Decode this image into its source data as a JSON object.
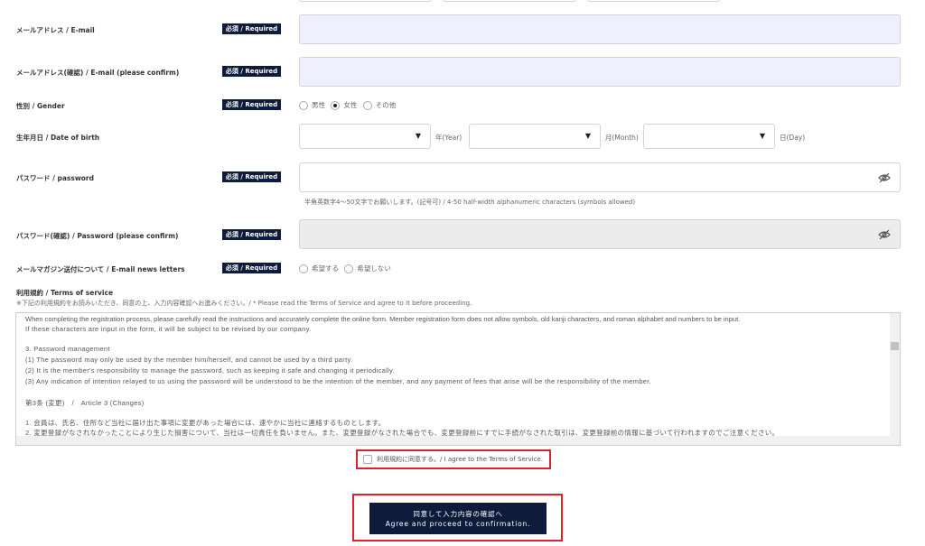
{
  "fields": {
    "email": {
      "label": "メールアドレス / E-mail",
      "badge": "必須 / Required"
    },
    "email_confirm": {
      "label": "メールアドレス(確認) / E-mail (please confirm)",
      "badge": "必須 / Required"
    },
    "gender": {
      "label": "性別 / Gender",
      "badge": "必須 / Required",
      "options": [
        "男性",
        "女性",
        "その他"
      ],
      "selected": "女性"
    },
    "dob": {
      "label": "生年月日 / Date of birth",
      "year_unit": "年(Year)",
      "month_unit": "月(Month)",
      "day_unit": "日(Day)"
    },
    "password": {
      "label": "パスワード / password",
      "badge": "必須 / Required",
      "hint": "半角英数字4～50文字でお願いします。(記号可) / 4-50 half-width alphanumeric characters (symbols allowed)"
    },
    "password_confirm": {
      "label": "パスワード(確認) / Password (please confirm)",
      "badge": "必須 / Required"
    },
    "newsletter": {
      "label": "メールマガジン送付について / E-mail news letters",
      "badge": "必須 / Required",
      "options": [
        "希望する",
        "希望しない"
      ]
    }
  },
  "terms": {
    "label": "利用規約 / Terms of service",
    "note": "※下記の利用規約をお読みいただき、同意の上、入力内容確認へお進みください。/ * Please read the Terms of Service and agree to it before proceeding.",
    "lines": [
      "When completing the registration process, please carefully read the instructions and accurately complete the online form. Member registration form does not allow symbols, old kanji characters, and roman alphabet and numbers to be input.",
      "If these characters are input in the form, it will be subject to be revised by our company.",
      "3. Password management",
      "(1) The password may only be used by the member him/herself, and cannot be used by a third party.",
      "(2) It is the member's responsibility to manage the password, such as keeping it safe and changing it periodically.",
      "(3) Any indication of intention relayed to us using the password will be understood to be the intention of the member, and any payment of fees that arise will be the responsibility of the member.",
      "第3条 (変更)　/　Article 3 (Changes)",
      "1. 会員は、氏名、住所など当社に届け出た事項に変更があった場合には、速やかに当社に連絡するものとします。",
      "2. 変更登録がなされなかったことにより生じた損害について、当社は一切責任を負いません。また、変更登録がなされた場合でも、変更登録前にすでに手続がなされた取引は、変更登録前の情報に基づいて行われますのでご注意ください。"
    ],
    "agree_label": "利用規約に同意する。/ I agree to the Terms of Service.",
    "agreed": false
  },
  "submit": {
    "line1": "同意して入力内容の確認へ",
    "line2": "Agree and proceed to confirmation."
  },
  "colors": {
    "navy": "#0f1b3a",
    "highlight": "#d9232e",
    "input_lavender": "#eef0fd"
  }
}
